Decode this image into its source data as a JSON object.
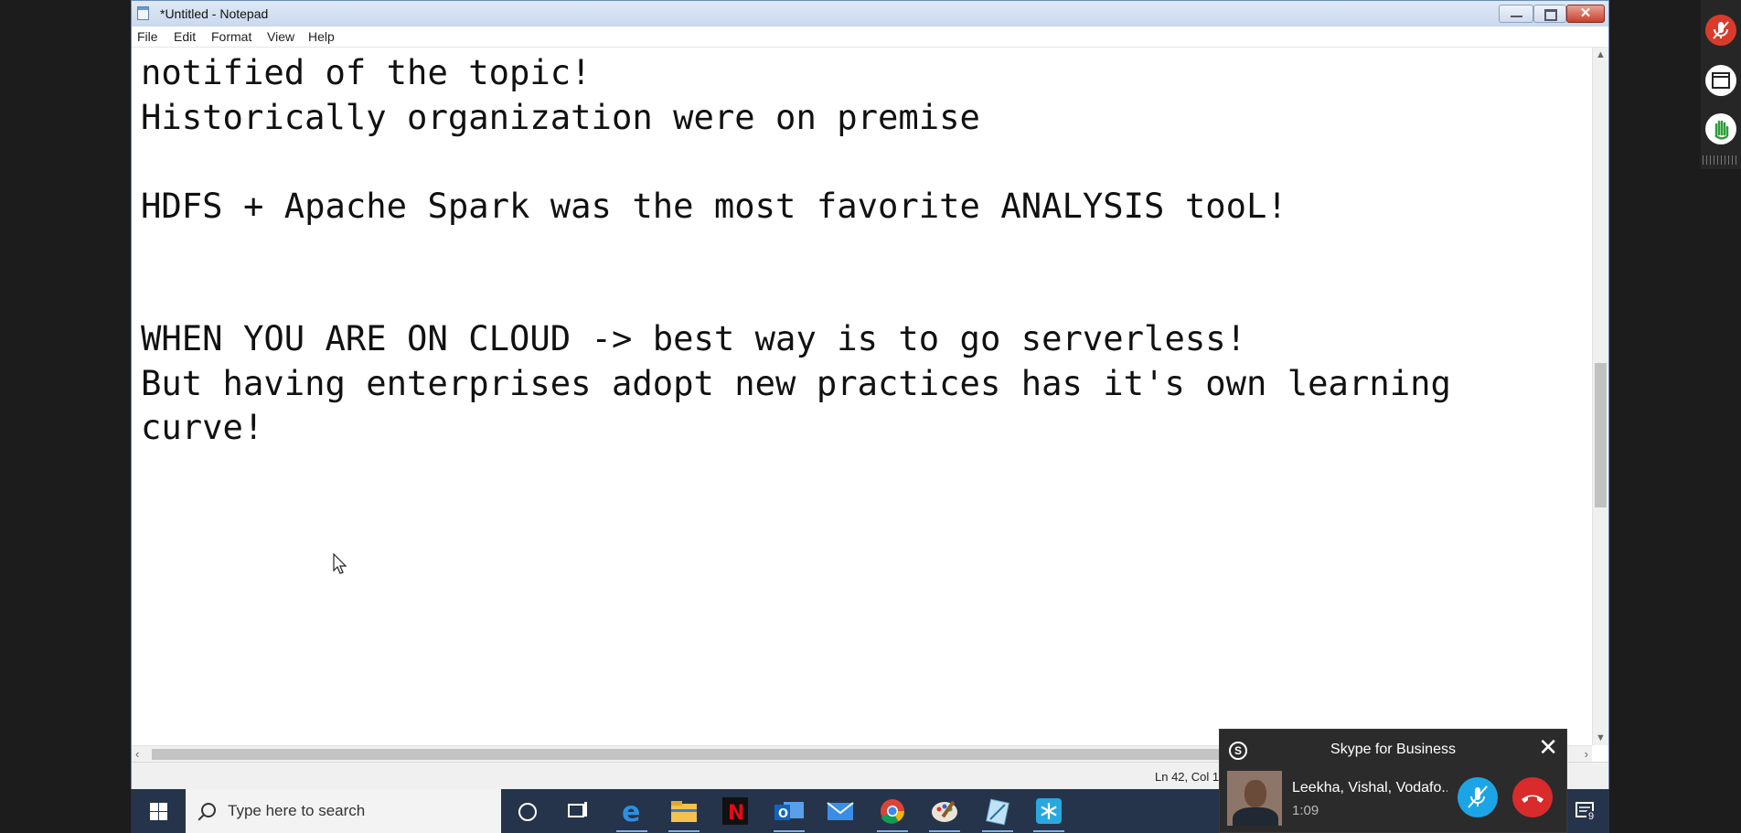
{
  "window": {
    "title": "*Untitled - Notepad"
  },
  "menubar": {
    "items": [
      "File",
      "Edit",
      "Format",
      "View",
      "Help"
    ]
  },
  "editor": {
    "lines": [
      "notified of the topic!",
      "Historically organization were on premise",
      "",
      "HDFS + Apache Spark was the most favorite ANALYSIS tooL!",
      "",
      "",
      "WHEN YOU ARE ON CLOUD -> best way is to go serverless!",
      "But having enterprises adopt new practices has it's own learning",
      "curve!"
    ]
  },
  "statusbar": {
    "position": "Ln 42, Col 1"
  },
  "taskbar": {
    "search_placeholder": "Type here to search",
    "pinned_icons": [
      "cortana-icon",
      "task-view-icon",
      "edge-icon",
      "file-explorer-icon",
      "netflix-icon",
      "outlook-icon",
      "mail-icon",
      "chrome-icon",
      "paint-icon",
      "snipping-tool-icon",
      "snowflake-app-icon"
    ],
    "notification_count": "9"
  },
  "skype": {
    "title": "Skype for Business",
    "caller": "Leekha, Vishal, Vodafo...",
    "duration": "1:09"
  },
  "colors": {
    "taskbar": "#25344a",
    "skype_mute": "#1ca5e6",
    "skype_hangup": "#d92b2b",
    "side_mic": "#d93b2b",
    "side_hand": "#2f9e3a"
  }
}
